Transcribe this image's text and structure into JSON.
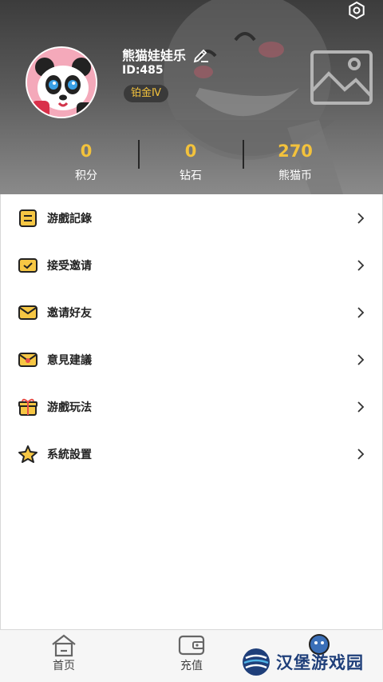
{
  "profile": {
    "name": "熊猫娃娃乐",
    "id_text": "ID:485",
    "rank": "铂金Ⅳ"
  },
  "stats": [
    {
      "value": "0",
      "label": "积分"
    },
    {
      "value": "0",
      "label": "钻石"
    },
    {
      "value": "270",
      "label": "熊猫币"
    }
  ],
  "menu": [
    {
      "label": "游戲記錄",
      "icon": "game-record-icon"
    },
    {
      "label": "接受邀请",
      "icon": "accept-invite-icon"
    },
    {
      "label": "邀请好友",
      "icon": "invite-friend-icon"
    },
    {
      "label": "意見建議",
      "icon": "feedback-icon"
    },
    {
      "label": "游戲玩法",
      "icon": "gameplay-icon"
    },
    {
      "label": "系統設置",
      "icon": "system-settings-icon"
    }
  ],
  "nav": [
    {
      "label": "首页",
      "icon": "home-icon"
    },
    {
      "label": "充值",
      "icon": "wallet-icon"
    },
    {
      "label": "",
      "icon": "profile-icon"
    }
  ],
  "watermark": {
    "text": "汉堡游戏园"
  },
  "colors": {
    "accent": "#f3c23c",
    "icon_fill": "#f6c744",
    "header_dark": "#3c3c3c"
  }
}
